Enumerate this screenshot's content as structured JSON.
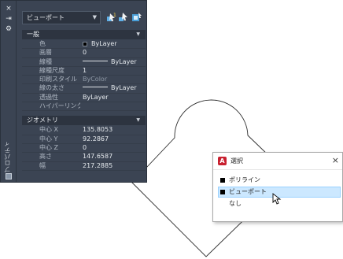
{
  "palette": {
    "strip_close_glyph": "×",
    "strip_autohide_glyph": "⇥",
    "strip_settings_glyph": "⚙",
    "strip_title": "プロパティ",
    "object_select": "ビューポート",
    "sections": [
      {
        "title": "一般",
        "rows": [
          {
            "name": "色",
            "value": "ByLayer",
            "swatch": true
          },
          {
            "name": "画層",
            "value": "0"
          },
          {
            "name": "線種",
            "value": "ByLayer",
            "dash": true
          },
          {
            "name": "線種尺度",
            "value": "1"
          },
          {
            "name": "印刷スタイル",
            "value": "ByColor",
            "disabled": true
          },
          {
            "name": "線の太さ",
            "value": "ByLayer",
            "dash": true
          },
          {
            "name": "透過性",
            "value": "ByLayer"
          },
          {
            "name": "ハイパーリンク",
            "value": ""
          }
        ]
      },
      {
        "title": "ジオメトリ",
        "rows": [
          {
            "name": "中心 X",
            "value": "135.8053"
          },
          {
            "name": "中心 Y",
            "value": "92.2867"
          },
          {
            "name": "中心 Z",
            "value": "0"
          },
          {
            "name": "高さ",
            "value": "147.6587"
          },
          {
            "name": "幅",
            "value": "217.2885"
          }
        ]
      }
    ]
  },
  "popup": {
    "title": "選択",
    "app_icon_letter": "A",
    "close_glyph": "×",
    "items": [
      {
        "label": "ポリライン",
        "square": true
      },
      {
        "label": "ビューポート",
        "square": true,
        "highlighted": true
      },
      {
        "label": "なし",
        "square": false
      }
    ]
  },
  "colors": {
    "palette_bg": "#3b4453",
    "section_header_bg": "#2d3440",
    "popup_highlight": "#cce8ff",
    "app_icon": "#c8202f"
  }
}
